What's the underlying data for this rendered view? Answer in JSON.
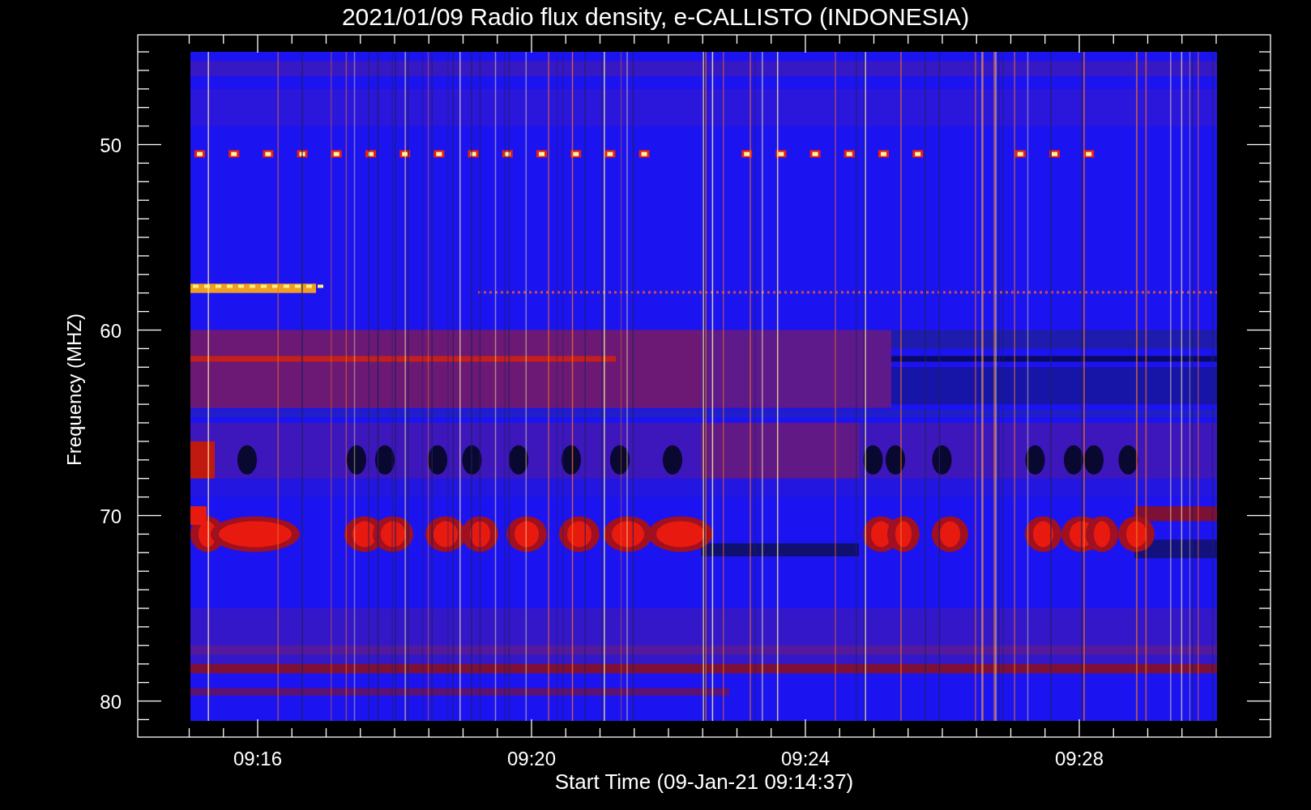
{
  "title": "2021/01/09  Radio flux density, e-CALLISTO (INDONESIA)",
  "y_axis": {
    "label": "Frequency (MHZ)",
    "ticks": [
      "50",
      "60",
      "70",
      "80"
    ]
  },
  "x_axis": {
    "label": "Start Time (09-Jan-21 09:14:37)",
    "ticks": [
      "09:16",
      "09:20",
      "09:24",
      "09:28"
    ]
  }
}
